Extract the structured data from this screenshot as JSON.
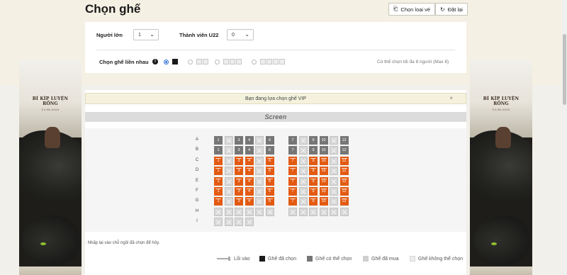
{
  "header": {
    "title": "Chọn ghế",
    "choose_ticket_label": "Chọn loại vé",
    "reset_label": "Đặt lại"
  },
  "filters": {
    "adult_label": "Người lớn",
    "adult_value": "1",
    "u22_label": "Thành viên U22",
    "u22_value": "0",
    "adjacent_label": "Chọn ghế liền nhau",
    "max_note": "Có thể chọn tối đa 8 người (Max 8)"
  },
  "notice": {
    "vip_text": "Bạn đang lựa chọn ghế VIP",
    "close_label": "×"
  },
  "screen_label": "Screen",
  "seatmap": {
    "rows": [
      {
        "label": "A",
        "seats": [
          "1:a",
          "2:x",
          "3:a",
          "4:a",
          "5:x",
          "6:a",
          "",
          "7:a",
          "8:x",
          "9:a",
          "10:a",
          "11:x",
          "12:a"
        ]
      },
      {
        "label": "B",
        "seats": [
          "1:a",
          "2:x",
          "3:a",
          "4:a",
          "5:x",
          "6:a",
          "",
          "7:a",
          "8:x",
          "9:a",
          "10:a",
          "11:x",
          "12:a"
        ]
      },
      {
        "label": "C",
        "seats": [
          "1:v",
          "2:x",
          "3:v",
          "4:v",
          "5:x",
          "6:v",
          "",
          "7:v",
          "8:x",
          "9:v",
          "10:v",
          "11:x",
          "12:v"
        ]
      },
      {
        "label": "D",
        "seats": [
          "1:v",
          "2:x",
          "3:v",
          "4:v",
          "5:x",
          "6:v",
          "",
          "7:v",
          "8:x",
          "9:v",
          "10:v",
          "11:x",
          "12:v"
        ]
      },
      {
        "label": "E",
        "seats": [
          "1:v",
          "2:x",
          "3:v",
          "4:v",
          "5:x",
          "6:v",
          "",
          "7:v",
          "8:x",
          "9:v",
          "10:v",
          "11:x",
          "12:v"
        ]
      },
      {
        "label": "F",
        "seats": [
          "1:v",
          "2:x",
          "3:v",
          "4:v",
          "5:x",
          "6:v",
          "",
          "7:v",
          "8:x",
          "9:v",
          "10:v",
          "11:x",
          "12:v"
        ]
      },
      {
        "label": "G",
        "seats": [
          "1:v",
          "2:x",
          "3:v",
          "4:v",
          "5:x",
          "6:v",
          "",
          "7:v",
          "8:x",
          "9:v",
          "10:v",
          "11:x",
          "12:v"
        ]
      },
      {
        "label": "H",
        "seats": [
          "1:x",
          "2:x",
          "3:x",
          "4:x",
          "5:x",
          "6:x",
          "",
          "7:x",
          "8:x",
          "9:x",
          "10:x",
          "11:x",
          "12:x"
        ]
      },
      {
        "label": "I",
        "seats": [
          "1:x",
          "2:x",
          "3:x",
          "4:x"
        ]
      }
    ]
  },
  "instruction_note": "· Nhấp lại vào chỗ ngồi đã chọn để hủy.",
  "legend": {
    "entrance": "Lối vào",
    "selected": "Ghế đã chọn",
    "available": "Ghế có thể chọn",
    "sold": "Ghế đã mua",
    "unavailable": "Ghế không thể chọn"
  },
  "poster": {
    "logo_text": "BÍ KÍP LUYỆN RỒNG",
    "logo_sub": "13.06.2025"
  },
  "colors": {
    "vip": "#e35a12",
    "available": "#767676",
    "blocked": "#d7d7d7",
    "selected": "#1a1a1a",
    "background": "#f1ede1"
  }
}
